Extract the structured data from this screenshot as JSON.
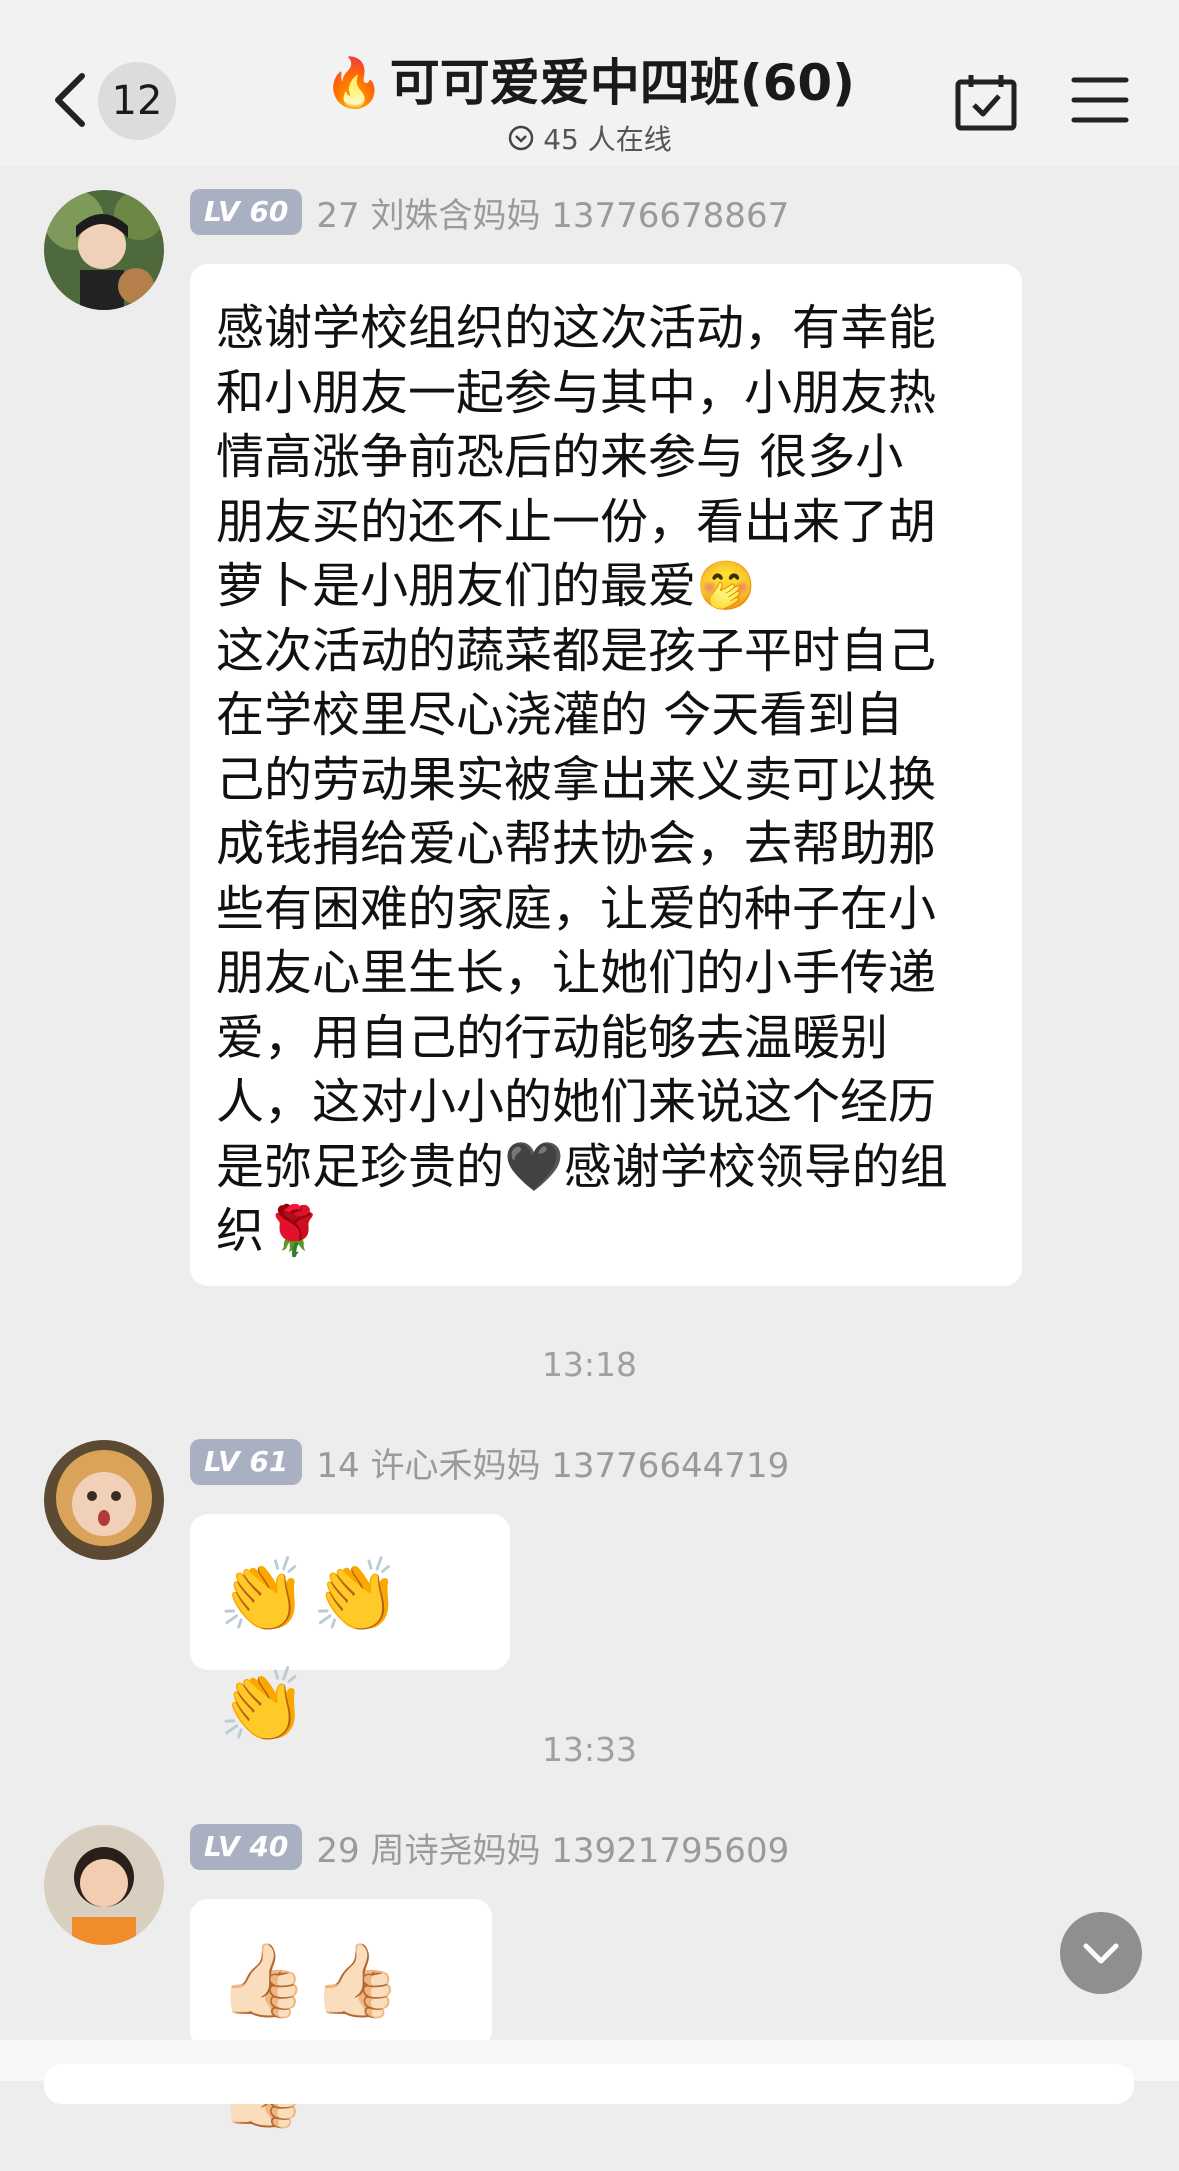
{
  "header": {
    "back_badge": "12",
    "title": "可可爱爱中四班(60)",
    "title_icon": "fire-emoji",
    "online_text": "45 人在线",
    "calendar_icon": "calendar-check-icon",
    "menu_icon": "menu-icon"
  },
  "messages": [
    {
      "level": "LV 60",
      "sender": "27 刘姝含妈妈 13776678867",
      "text": "感谢学校组织的这次活动，有幸能\n和小朋友一起参与其中，小朋友热\n情高涨争前恐后的来参与 很多小\n朋友买的还不止一份，看出来了胡\n萝卜是小朋友们的最爱🤭\n这次活动的蔬菜都是孩子平时自己\n在学校里尽心浇灌的 今天看到自\n己的劳动果实被拿出来义卖可以换\n成钱捐给爱心帮扶协会，去帮助那\n些有困难的家庭，让爱的种子在小\n朋友心里生长，让她们的小手传递\n爱，用自己的行动能够去温暖别\n人，这对小小的她们来说这个经历\n是弥足珍贵的🖤感谢学校领导的组\n织🌹"
    },
    {
      "time": "13:18",
      "level": "LV 61",
      "sender": "14 许心禾妈妈 13776644719",
      "text": "👏👏👏"
    },
    {
      "time": "13:33",
      "level": "LV 40",
      "sender": "29 周诗尧妈妈 13921795609",
      "text": "👍🏻👍🏻👍🏻"
    }
  ],
  "colors": {
    "background": "#ededed",
    "header": "#f2f2f2",
    "level_badge": "#a9b0c2",
    "bubble": "#ffffff"
  }
}
